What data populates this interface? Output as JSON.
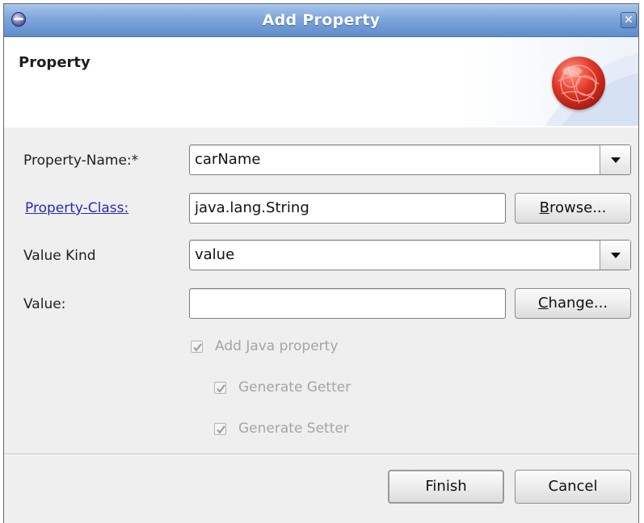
{
  "window": {
    "title": "Add Property"
  },
  "header": {
    "title": "Property"
  },
  "form": {
    "property_name": {
      "label": "Property-Name:*",
      "value": "carName"
    },
    "property_class": {
      "label": "Property-Class:",
      "value": "java.lang.String",
      "browse_label_prefix": "",
      "browse_mnemonic": "B",
      "browse_label_rest": "rowse..."
    },
    "value_kind": {
      "label": "Value Kind",
      "value": "value"
    },
    "value": {
      "label": "Value:",
      "value": "",
      "change_mnemonic": "C",
      "change_label_rest": "hange..."
    }
  },
  "options": {
    "add_java_property": {
      "label": "Add Java property",
      "checked": true,
      "enabled": false
    },
    "generate_getter": {
      "label": "Generate Getter",
      "checked": true,
      "enabled": false
    },
    "generate_setter": {
      "label": "Generate Setter",
      "checked": true,
      "enabled": false
    }
  },
  "buttons": {
    "finish": "Finish",
    "cancel": "Cancel"
  },
  "icons": {
    "app": "eclipse-icon",
    "close": "close-icon",
    "banner": "red-globe-icon"
  },
  "colors": {
    "titlebar": "#7ea6db",
    "link": "#2a2ab4",
    "disabled_text": "#a5a5a5",
    "banner_ball": "#e23a2a"
  }
}
